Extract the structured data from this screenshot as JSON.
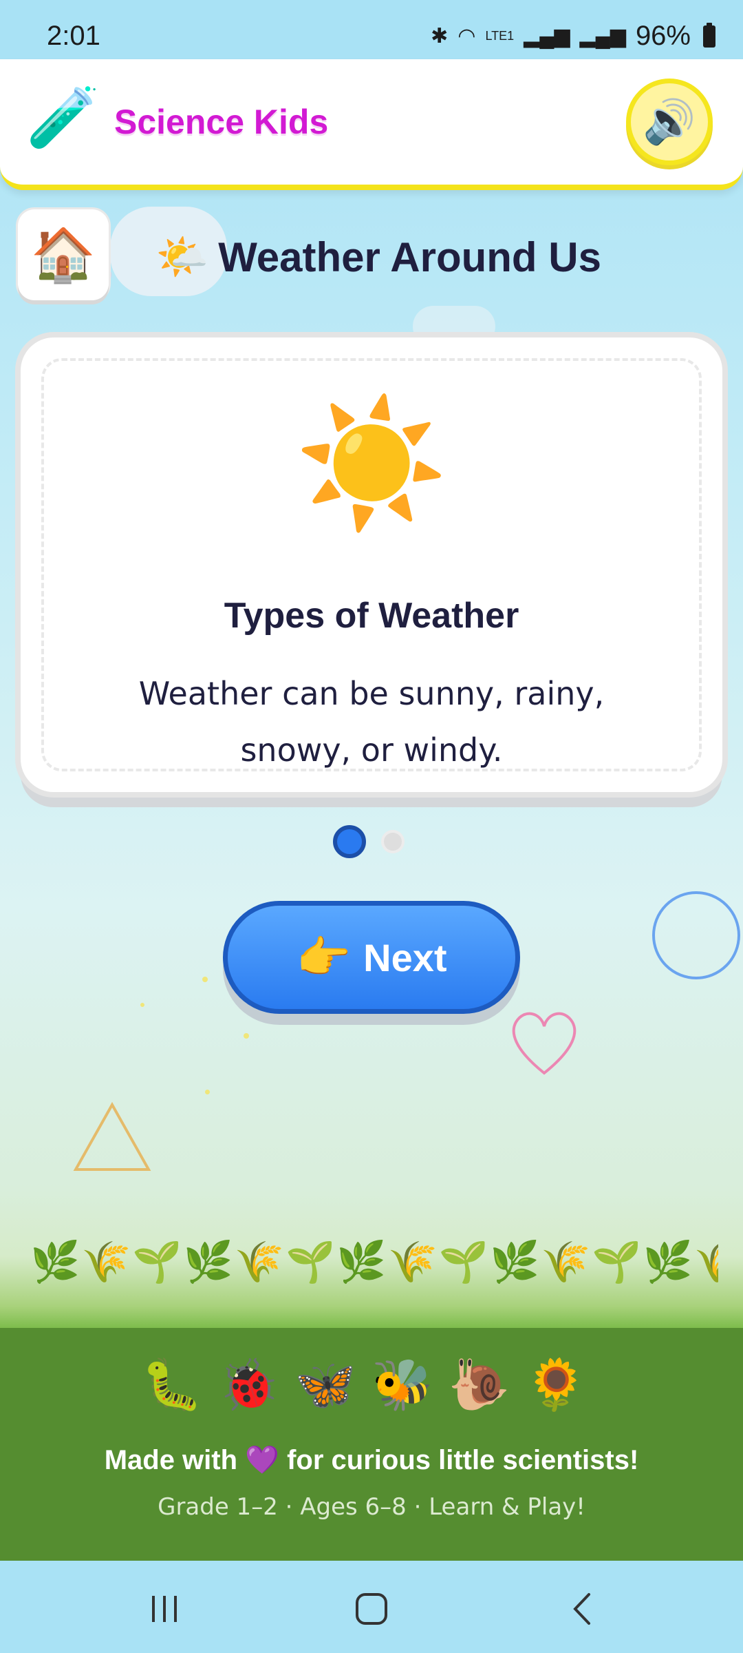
{
  "status_bar": {
    "time": "2:01",
    "battery": "96%",
    "network": "LTE1"
  },
  "header": {
    "title": "Science Kids",
    "logo_icon": "test-tube-icon",
    "sound_icon": "speaker-icon"
  },
  "page": {
    "heading": "Weather Around Us",
    "heading_icon": "sun-behind-cloud-icon",
    "home_icon": "house-icon"
  },
  "card": {
    "icon": "sun-icon",
    "title": "Types of Weather",
    "body": "Weather can be sunny, rainy, snowy, or windy."
  },
  "pagination": {
    "current": 1,
    "total": 2
  },
  "next_button": {
    "label": "Next",
    "icon": "pointing-right-icon"
  },
  "footer": {
    "tagline_before": "Made with",
    "tagline_after": "for curious little scientists!",
    "subline": "Grade 1–2 · Ages 6–8 · Learn & Play!",
    "critters": [
      "caterpillar",
      "ladybug",
      "butterfly",
      "bee",
      "snail",
      "sunflower"
    ]
  },
  "colors": {
    "brand": "#d21ad3",
    "accent_yellow": "#f4e31b",
    "primary_blue": "#2a7bf0",
    "footer_green": "#558d30",
    "text_dark": "#1f1f3f"
  }
}
